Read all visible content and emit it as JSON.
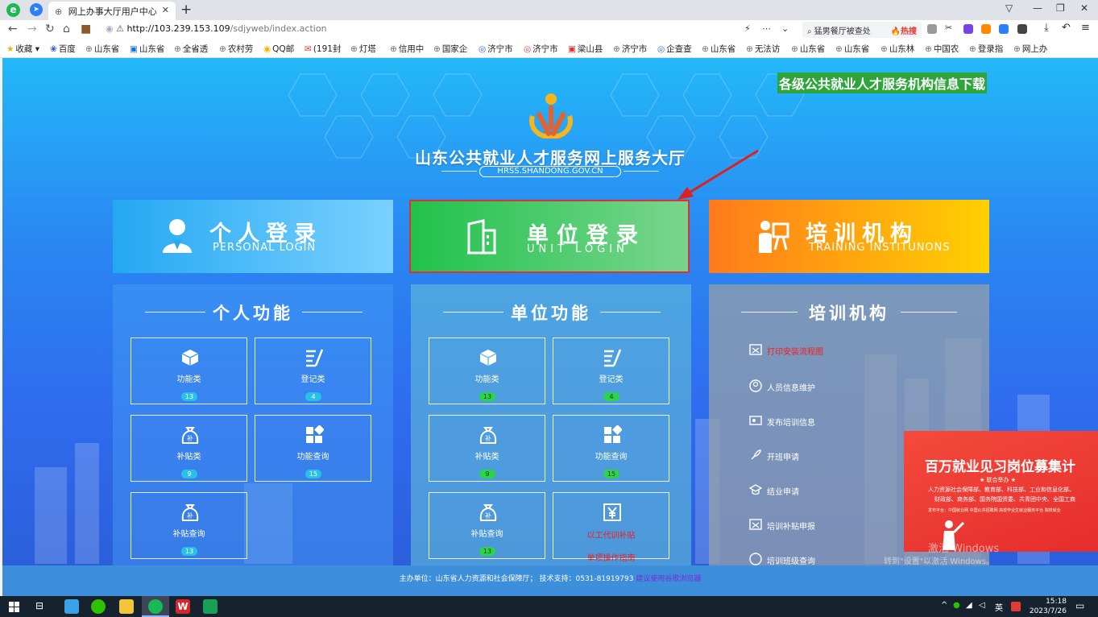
{
  "browser": {
    "tab_title": "网上办事大厅用户中心",
    "tab_close": "✕",
    "new_tab": "+",
    "address_host": "http://103.239.153.109",
    "address_path": "/sdjyweb/index.action",
    "address_menu": "⋯",
    "search_placeholder": "猛男餐厅被查处",
    "search_hot": "🔥热搜",
    "window_controls": [
      "▽",
      "—",
      "❐",
      "✕"
    ],
    "bookmarks": [
      {
        "label": "收藏",
        "icon": "★"
      },
      {
        "label": "百度",
        "icon": "❀"
      },
      {
        "label": "山东省",
        "icon": "⊕"
      },
      {
        "label": "山东省",
        "icon": "▣"
      },
      {
        "label": "全省透",
        "icon": "⊕"
      },
      {
        "label": "农村劳",
        "icon": "⊕"
      },
      {
        "label": "QQ邮",
        "icon": "◉"
      },
      {
        "label": "(191封",
        "icon": "✉"
      },
      {
        "label": "灯塔",
        "icon": "⊕"
      },
      {
        "label": "信用中",
        "icon": "⊕"
      },
      {
        "label": "国家企",
        "icon": "⊕"
      },
      {
        "label": "济宁市",
        "icon": "◎"
      },
      {
        "label": "济宁市",
        "icon": "◎"
      },
      {
        "label": "梁山县",
        "icon": "▣"
      },
      {
        "label": "济宁市",
        "icon": "⊕"
      },
      {
        "label": "企查查",
        "icon": "◎"
      },
      {
        "label": "山东省",
        "icon": "⊕"
      },
      {
        "label": "无法访",
        "icon": "⊕"
      },
      {
        "label": "山东省",
        "icon": "⊕"
      },
      {
        "label": "山东省",
        "icon": "⊕"
      },
      {
        "label": "山东林",
        "icon": "⊕"
      },
      {
        "label": "中国农",
        "icon": "⊕"
      },
      {
        "label": "登录指",
        "icon": "⊕"
      },
      {
        "label": "网上办",
        "icon": "⊕"
      }
    ]
  },
  "header": {
    "download_link": "各级公共就业人才服务机构信息下载",
    "site_title": "山东公共就业人才服务网上服务大厅",
    "site_domain": "HRSS.SHANDONG.GOV.CN"
  },
  "login_cards": [
    {
      "title": "个人登录",
      "subtitle": "PERSONAL LOGIN"
    },
    {
      "title": "单位登录",
      "subtitle": "UNIT LOGIN"
    },
    {
      "title": "培训机构",
      "subtitle": "TRAINING INSTITUNONS"
    }
  ],
  "personal_panel": {
    "heading": "个人功能",
    "tiles": [
      {
        "label": "功能类",
        "badge": "13",
        "icon": "cube-icon"
      },
      {
        "label": "登记类",
        "badge": "4",
        "icon": "list-edit-icon"
      },
      {
        "label": "补贴类",
        "badge": "9",
        "icon": "money-bag-icon"
      },
      {
        "label": "功能查询",
        "badge": "15",
        "icon": "grid-icon"
      },
      {
        "label": "补贴查询",
        "badge": "13",
        "icon": "money-bag-icon"
      }
    ]
  },
  "unit_panel": {
    "heading": "单位功能",
    "tiles": [
      {
        "label": "功能类",
        "badge": "13",
        "icon": "cube-icon"
      },
      {
        "label": "登记类",
        "badge": "4",
        "icon": "list-edit-icon"
      },
      {
        "label": "补贴类",
        "badge": "9",
        "icon": "money-bag-icon"
      },
      {
        "label": "功能查询",
        "badge": "15",
        "icon": "grid-icon"
      },
      {
        "label": "补贴查询",
        "badge": "13",
        "icon": "money-bag-icon"
      },
      {
        "label": "以工代训补贴",
        "label2": "单项操作指南",
        "icon": "yen-frame-icon"
      }
    ]
  },
  "training_panel": {
    "heading": "培训机构",
    "items": [
      {
        "label": "打印安装流程图",
        "highlight": true
      },
      {
        "label": "人员信息维护",
        "highlight": false
      },
      {
        "label": "发布培训信息",
        "highlight": false
      },
      {
        "label": "开班申请",
        "highlight": false
      },
      {
        "label": "结业申请",
        "highlight": false
      },
      {
        "label": "培训补贴申报",
        "highlight": false
      },
      {
        "label": "培训班级查询",
        "highlight": false
      }
    ]
  },
  "promo": {
    "title": "百万就业见习岗位募集计",
    "org_label": "★ 联合举办 ★",
    "line1": "人力资源社会保障部、教育部、科技部、工业和信息化部、",
    "line2": "财政部、商务部、国务院国资委、共青团中央、全国工商",
    "line3": "发布平台：中国就业网  中国公共招聘网  高校毕业生就业服务平台  院校就业"
  },
  "watermark": {
    "line1": "激活 Windows",
    "line2": "转到\"设置\"以激活 Windows。"
  },
  "footer": {
    "sponsor": "主办单位：山东省人力资源和社会保障厅；  技术支持：0531-81919793",
    "browser_link": "建议使用谷歌浏览器"
  },
  "taskbar": {
    "ime": "英",
    "time": "15:18",
    "date": "2023/7/26"
  },
  "colors": {
    "personal_card": "#24a8f2",
    "unit_card": "#21c24c",
    "training_card": "#ff7a1c",
    "highlight_border": "#e03030",
    "download_bg": "#2da53a",
    "footer_bg": "#3d8edb"
  }
}
